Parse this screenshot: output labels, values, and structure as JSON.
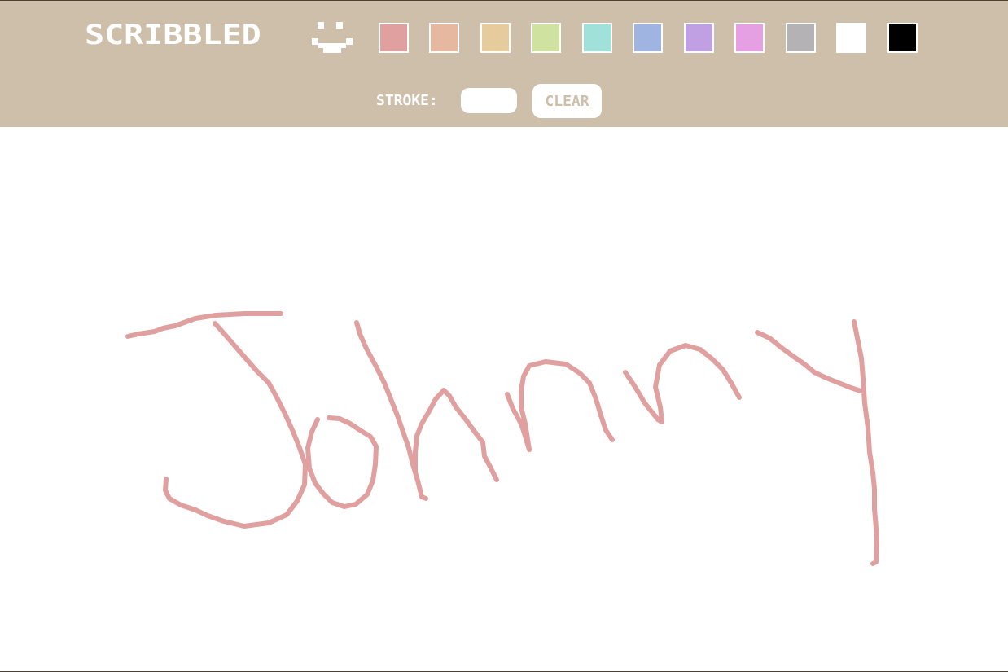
{
  "app": {
    "title": "SCRIBBLED"
  },
  "palette": {
    "colors": [
      "#e0a0a0",
      "#e6b8a0",
      "#e6cc9c",
      "#d0e2a0",
      "#a0e2da",
      "#a0b4e2",
      "#c0a0e2",
      "#e4a0e2",
      "#b4b2b4",
      "#ffffff",
      "#000000"
    ],
    "selected": "#e0a0a0"
  },
  "controls": {
    "stroke_label": "STROKE:",
    "stroke_value": "",
    "clear_label": "CLEAR"
  },
  "drawing": {
    "stroke_color": "#e0a0a0",
    "written_word": "Johnny"
  }
}
